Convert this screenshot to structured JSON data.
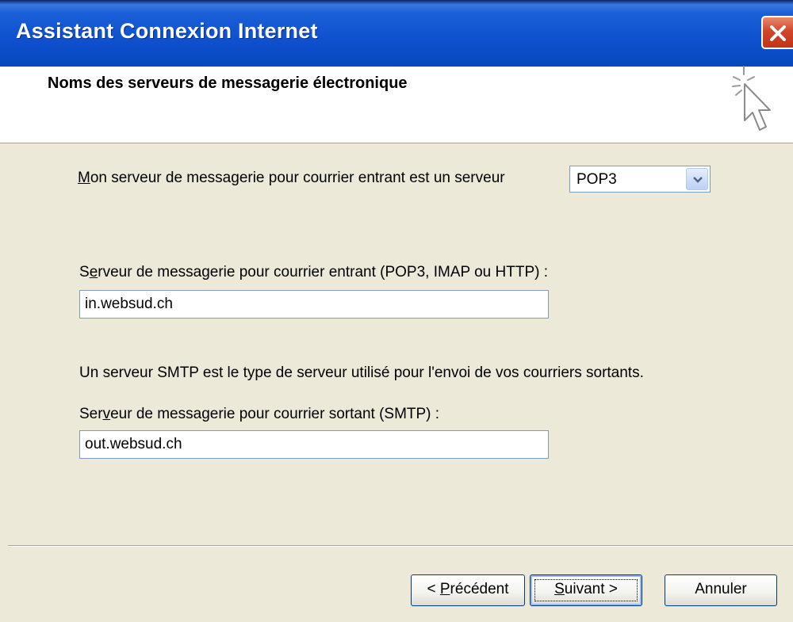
{
  "window": {
    "title": "Assistant Connexion Internet"
  },
  "header": {
    "title": "Noms des serveurs de messagerie électronique",
    "icon": "wizard-cursor-icon"
  },
  "incoming_type": {
    "label_first_letter": "M",
    "label_rest": "on serveur de messagerie pour courrier entrant est un serveur",
    "selected": "POP3"
  },
  "incoming_server": {
    "label_first_letter": "S",
    "label_accel_letter": "e",
    "label_rest": "rveur de messagerie pour courrier entrant (POP3, IMAP ou HTTP) :",
    "value": "in.websud.ch"
  },
  "smtp_info": "Un serveur SMTP est le type de serveur utilisé pour l'envoi de vos courriers sortants.",
  "outgoing_server": {
    "label_prefix": "Ser",
    "label_accel_letter": "v",
    "label_rest": "eur de messagerie pour courrier sortant (SMTP) :",
    "value": "out.websud.ch"
  },
  "buttons": {
    "back_prefix": "< ",
    "back_accel": "P",
    "back_rest": "récédent",
    "next_accel": "S",
    "next_rest": "uivant >",
    "cancel": "Annuler"
  },
  "colors": {
    "titlebar": "#0f52d0",
    "background": "#ece9d8",
    "close_button": "#d2452a"
  }
}
